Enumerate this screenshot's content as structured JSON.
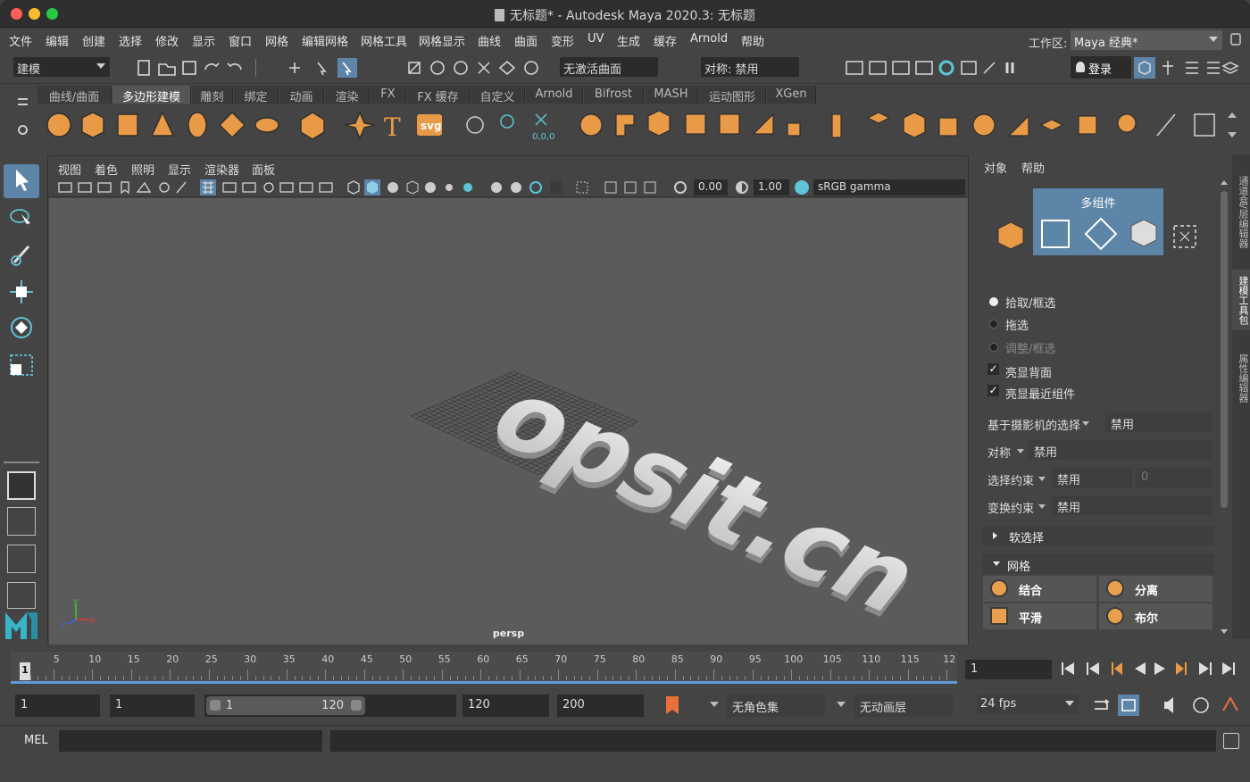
{
  "window": {
    "title": "无标题* - Autodesk Maya 2020.3: 无标题",
    "traffic_lights": [
      "#fe5f57",
      "#febc2e",
      "#28c840"
    ]
  },
  "menubar": {
    "items": [
      "文件",
      "编辑",
      "创建",
      "选择",
      "修改",
      "显示",
      "窗口",
      "网格",
      "编辑网格",
      "网格工具",
      "网格显示",
      "曲线",
      "曲面",
      "变形",
      "UV",
      "生成",
      "缓存",
      "Arnold",
      "帮助"
    ],
    "workspace_label": "工作区:",
    "workspace_value": "Maya 经典*"
  },
  "statusline": {
    "mode": "建模",
    "live_surface": "无激活曲面",
    "symmetry": "对称: 禁用",
    "login": "登录"
  },
  "shelf": {
    "tabs": [
      "曲线/曲面",
      "多边形建模",
      "雕刻",
      "绑定",
      "动画",
      "渲染",
      "FX",
      "FX 缓存",
      "自定义",
      "Arnold",
      "Bifrost",
      "MASH",
      "运动图形",
      "XGen"
    ],
    "active_tab": "多边形建模",
    "text_icon": "T",
    "svg_icon": "svg",
    "snap_label": "0,0,0"
  },
  "viewport": {
    "menu": [
      "视图",
      "着色",
      "照明",
      "显示",
      "渲染器",
      "面板"
    ],
    "exposure": "0.00",
    "gamma": "1.00",
    "color_space": "sRGB gamma",
    "camera": "persp",
    "scene_text": "opsit.cn",
    "axis_x": "x",
    "axis_y": "y",
    "axis_z": "z"
  },
  "modeling_toolkit": {
    "menu": [
      "对象",
      "帮助"
    ],
    "multi_component": "多组件",
    "pick_marquee": "拾取/框选",
    "drag": "拖选",
    "tweak_marquee": "调整/框选",
    "backface": "亮显背面",
    "nearest": "亮显最近组件",
    "camera_select_label": "基于摄影机的选择",
    "camera_select_value": "禁用",
    "symmetry_label": "对称",
    "symmetry_value": "禁用",
    "select_constraint_label": "选择约束",
    "select_constraint_value": "禁用",
    "select_constraint_num": "0",
    "transform_constraint_label": "变换约束",
    "transform_constraint_value": "禁用",
    "soft_select": "软选择",
    "mesh_section": "网格",
    "mesh_buttons": [
      "结合",
      "分离",
      "平滑",
      "布尔"
    ]
  },
  "side_tabs": [
    "通道盒/层编辑器",
    "建模工具包",
    "属性编辑器"
  ],
  "timeline": {
    "ticks": [
      "5",
      "10",
      "15",
      "20",
      "25",
      "30",
      "35",
      "40",
      "45",
      "50",
      "55",
      "60",
      "65",
      "70",
      "75",
      "80",
      "85",
      "90",
      "95",
      "100",
      "105",
      "110",
      "115",
      "12"
    ],
    "current_marker": "1",
    "current_frame": "1"
  },
  "range": {
    "start": "1",
    "playback_start": "1",
    "slider_start": "1",
    "slider_end": "120",
    "playback_end": "120",
    "end": "200",
    "character_set": "无角色集",
    "anim_layer": "无动画层",
    "fps": "24 fps"
  },
  "command": {
    "language": "MEL"
  }
}
